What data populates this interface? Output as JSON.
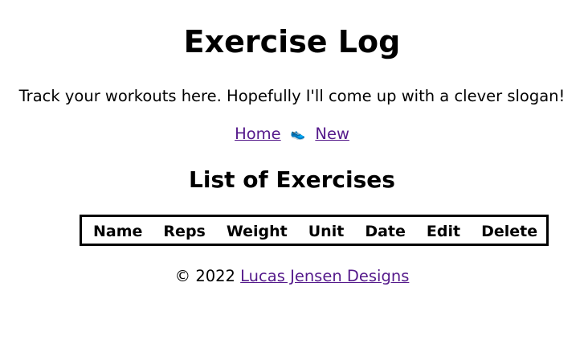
{
  "header": {
    "title": "Exercise Log",
    "slogan": "Track your workouts here. Hopefully I'll come up with a clever slogan!"
  },
  "nav": {
    "home_label": "Home",
    "separator_icon": "running-shoe-icon",
    "separator_glyph": "👟",
    "new_label": "New"
  },
  "main": {
    "section_title": "List of Exercises",
    "table": {
      "columns": [
        "Name",
        "Reps",
        "Weight",
        "Unit",
        "Date",
        "Edit",
        "Delete"
      ],
      "rows": []
    }
  },
  "footer": {
    "copyright": "© 2022",
    "link_label": "Lucas Jensen Designs"
  },
  "colors": {
    "link_visited": "#551a8b",
    "text": "#000000",
    "background": "#ffffff"
  }
}
